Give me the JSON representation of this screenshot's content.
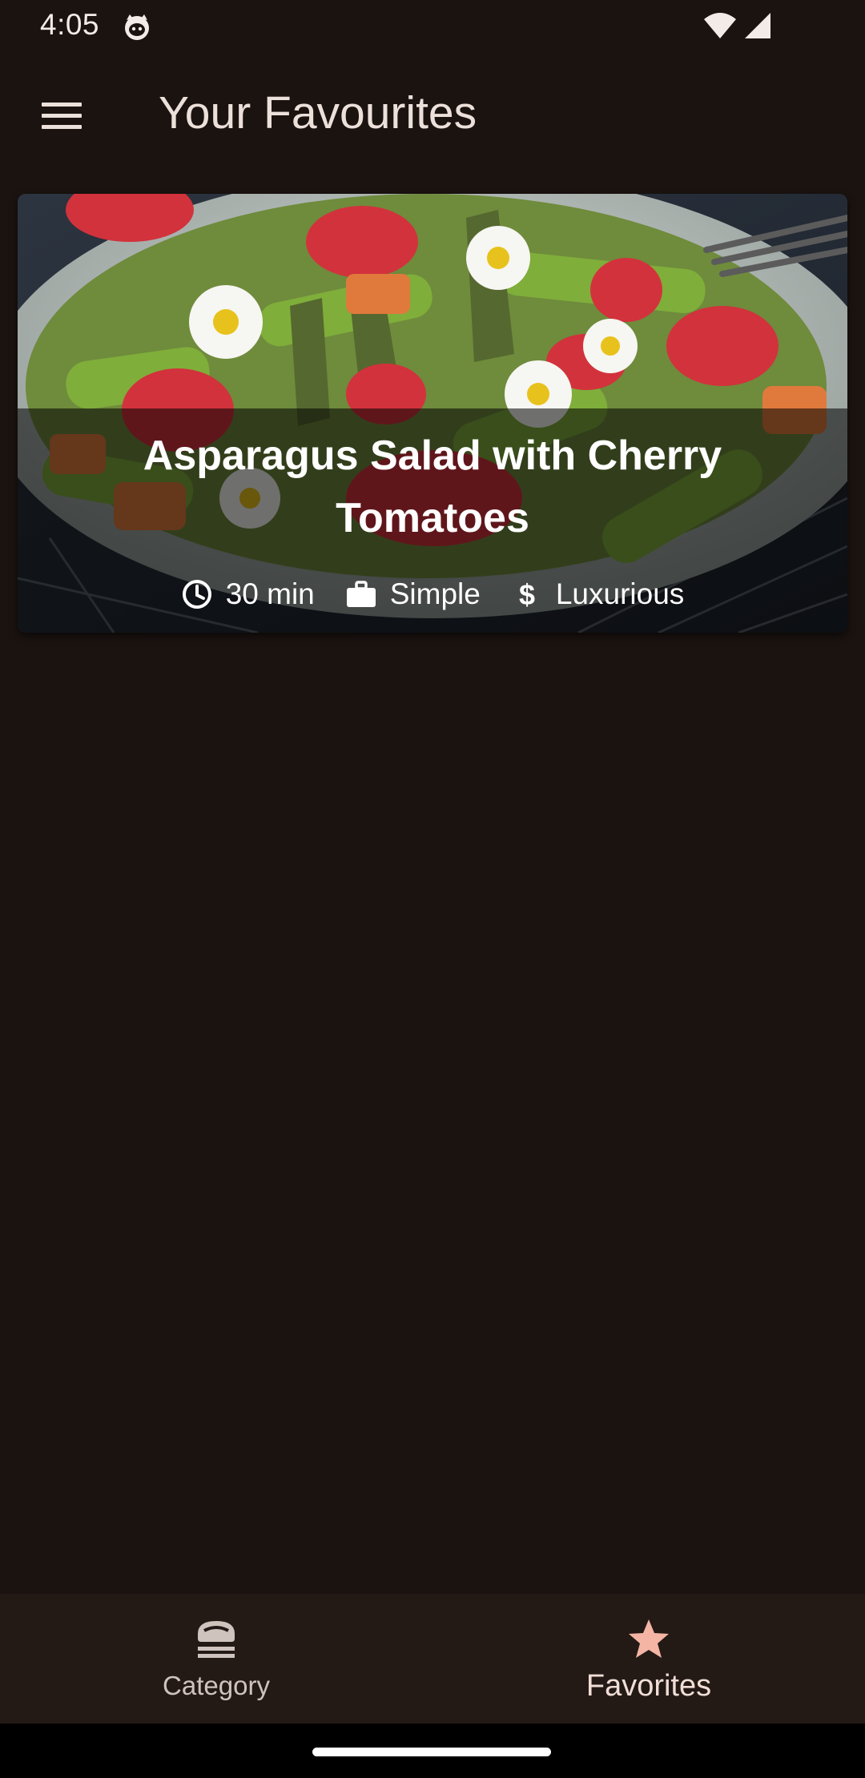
{
  "status_bar": {
    "time": "4:05",
    "app_icon": "cat-face-icon",
    "wifi_icon": "wifi-icon",
    "signal_icon": "cell-signal-icon"
  },
  "app_bar": {
    "menu_icon": "hamburger-menu-icon",
    "title": "Your Favourites"
  },
  "meals": [
    {
      "title": "Asparagus Salad with Cherry Tomatoes",
      "duration": "30 min",
      "complexity": "Simple",
      "affordability": "Luxurious",
      "icons": [
        "clock-icon",
        "briefcase-icon",
        "dollar-icon"
      ]
    }
  ],
  "bottom_nav": {
    "items": [
      {
        "label": "Category",
        "icon": "set-meal-icon",
        "selected": false
      },
      {
        "label": "Favorites",
        "icon": "star-icon",
        "selected": true
      }
    ]
  },
  "colors": {
    "background": "#1b1310",
    "nav_background": "#231a16",
    "text_primary": "#ece0da",
    "favorites_star": "#f4b5a4"
  }
}
